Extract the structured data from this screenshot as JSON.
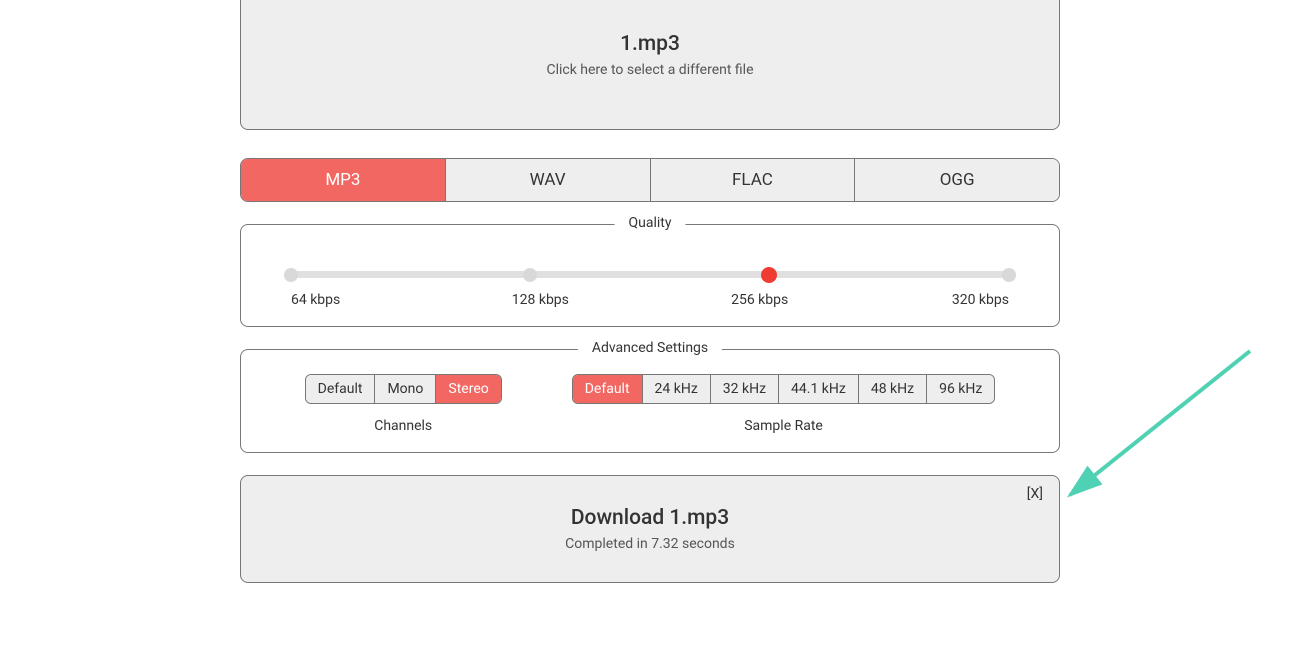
{
  "file": {
    "name": "1.mp3",
    "hint": "Click here to select a different file"
  },
  "tabs": {
    "t0": "MP3",
    "t1": "WAV",
    "t2": "FLAC",
    "t3": "OGG"
  },
  "quality": {
    "legend": "Quality",
    "labels": {
      "l0": "64 kbps",
      "l1": "128 kbps",
      "l2": "256 kbps",
      "l3": "320 kbps"
    }
  },
  "advanced": {
    "legend": "Advanced Settings",
    "channels": {
      "label": "Channels",
      "opts": {
        "o0": "Default",
        "o1": "Mono",
        "o2": "Stereo"
      }
    },
    "sample": {
      "label": "Sample Rate",
      "opts": {
        "o0": "Default",
        "o1": "24 kHz",
        "o2": "32 kHz",
        "o3": "44.1 kHz",
        "o4": "48 kHz",
        "o5": "96 kHz"
      }
    }
  },
  "download": {
    "title": "Download 1.mp3",
    "status": "Completed in 7.32 seconds",
    "close": "[X]"
  }
}
